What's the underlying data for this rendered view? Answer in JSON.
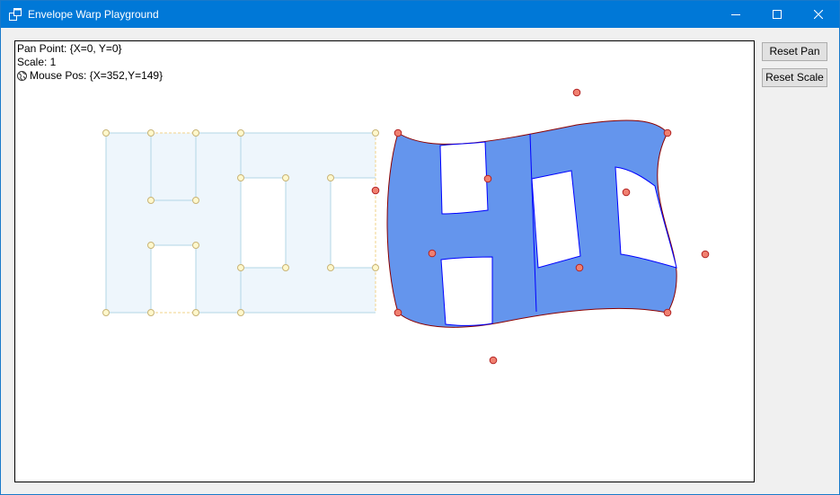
{
  "window": {
    "title": "Envelope Warp Playground",
    "accent_color": "#0078d7"
  },
  "info": {
    "pan_point": "Pan Point: {X=0, Y=0}",
    "scale": "Scale: 1",
    "mouse_pos": "Mouse Pos: {X=352,Y=149}",
    "mouse_icon": "globe-icon"
  },
  "buttons": {
    "reset_pan": "Reset Pan",
    "reset_scale": "Reset Scale"
  },
  "colors": {
    "source_fill": "#eef6fc",
    "source_stroke": "#b3d7e6",
    "source_handle": "#fff8cc",
    "warped_fill": "#6495ed",
    "warped_stroke": "#0000ff",
    "envelope_stroke": "#8b0000",
    "envelope_handle": "#f08070"
  }
}
